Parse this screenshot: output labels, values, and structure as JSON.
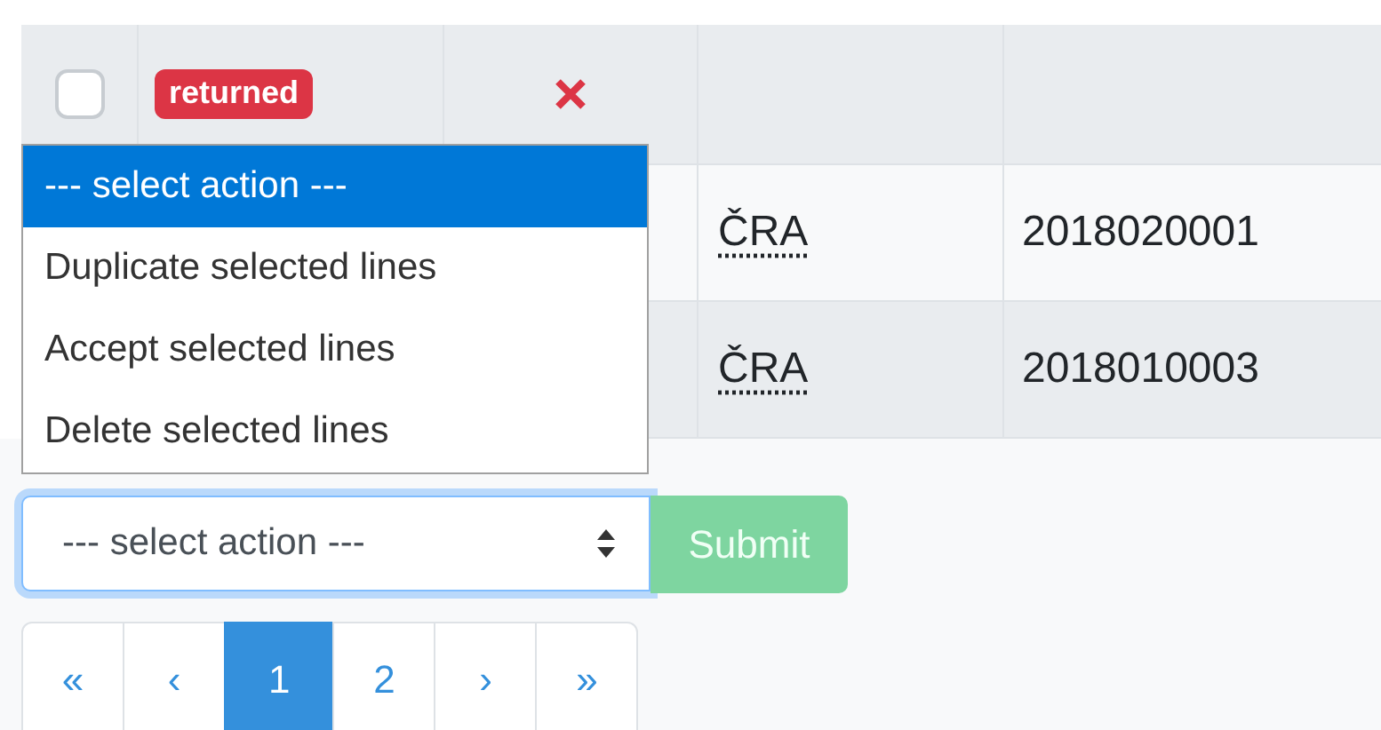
{
  "table": {
    "rows": [
      {
        "checked": false,
        "status": "returned"
      },
      {
        "code": "ČRA",
        "number": "2018020001"
      },
      {
        "code": "ČRA",
        "number": "2018010003"
      }
    ]
  },
  "action_dropdown": {
    "options": [
      {
        "label": "--- select action ---",
        "selected": true
      },
      {
        "label": "Duplicate selected lines",
        "selected": false
      },
      {
        "label": "Accept selected lines",
        "selected": false
      },
      {
        "label": "Delete selected lines",
        "selected": false
      }
    ]
  },
  "action_select": {
    "value": "--- select action ---"
  },
  "submit": {
    "label": "Submit",
    "disabled": true
  },
  "pagination": [
    {
      "label": "«",
      "selected": false
    },
    {
      "label": "‹",
      "selected": false
    },
    {
      "label": "1",
      "selected": true
    },
    {
      "label": "2",
      "selected": false
    },
    {
      "label": "›",
      "selected": false
    },
    {
      "label": "»",
      "selected": false
    }
  ]
}
